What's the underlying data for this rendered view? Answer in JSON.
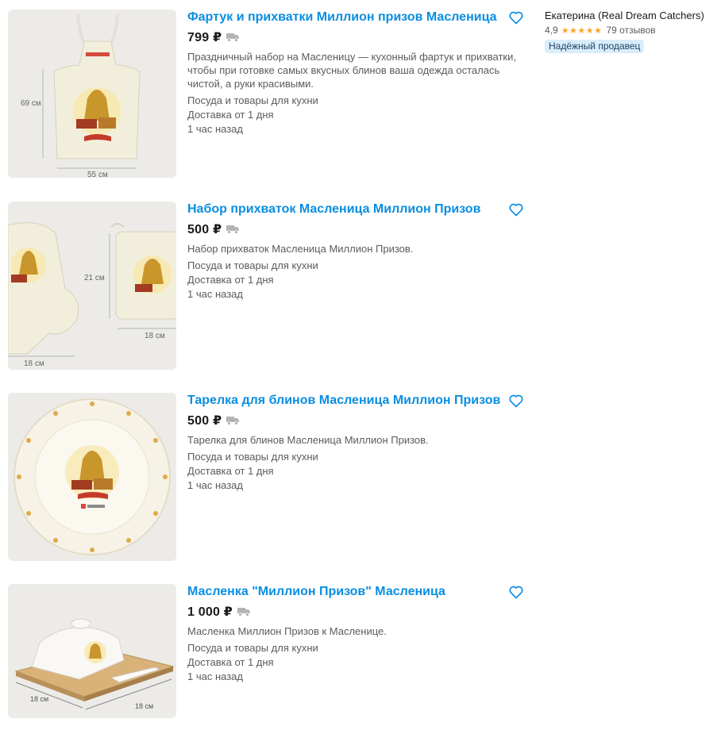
{
  "seller": {
    "name": "Екатерина (Real Dream Catchers)",
    "rating": "4,9",
    "stars": "★★★★★",
    "reviews": "79 отзывов",
    "badge": "Надёжный продавец"
  },
  "listings": [
    {
      "title": "Фартук и прихватки Миллион призов Масленица",
      "price": "799 ₽",
      "description": "Праздничный набор на Масленицу — кухонный фартук и прихватки, чтобы при готовке самых вкусных блинов ваша одежда осталась чистой, а руки красивыми.",
      "category": "Посуда и товары для кухни",
      "delivery": "Доставка от 1 дня",
      "posted": "1 час назад",
      "photo_labels": {
        "height": "69 см",
        "width": "55 см"
      },
      "favorite_icon": "heart-outline-icon",
      "delivery_icon": "truck-icon"
    },
    {
      "title": "Набор прихваток Масленица Миллион Призов",
      "price": "500 ₽",
      "description": "Набор прихваток Масленица Миллион Призов.",
      "category": "Посуда и товары для кухни",
      "delivery": "Доставка от 1 дня",
      "posted": "1 час назад",
      "photo_labels": {
        "mitt_width": "18 см",
        "holder_height": "21 см",
        "holder_width": "18 см"
      },
      "favorite_icon": "heart-outline-icon",
      "delivery_icon": "truck-icon"
    },
    {
      "title": "Тарелка для блинов Масленица Миллион Призов",
      "price": "500 ₽",
      "description": "Тарелка для блинов Масленица Миллион Призов.",
      "category": "Посуда и товары для кухни",
      "delivery": "Доставка от 1 дня",
      "posted": "1 час назад",
      "favorite_icon": "heart-outline-icon",
      "delivery_icon": "truck-icon"
    },
    {
      "title": "Масленка \"Миллион Призов\" Масленица",
      "price": "1 000 ₽",
      "description": "Масленка Миллион Призов к Масленице.",
      "category": "Посуда и товары для кухни",
      "delivery": "Доставка от 1 дня",
      "posted": "1 час назад",
      "photo_labels": {
        "depth": "18 см",
        "width": "18 см"
      },
      "favorite_icon": "heart-outline-icon",
      "delivery_icon": "truck-icon"
    }
  ],
  "colors": {
    "title_link": "#0a8ee0",
    "star": "#ffa726",
    "badge_bg": "#d9edfb"
  }
}
